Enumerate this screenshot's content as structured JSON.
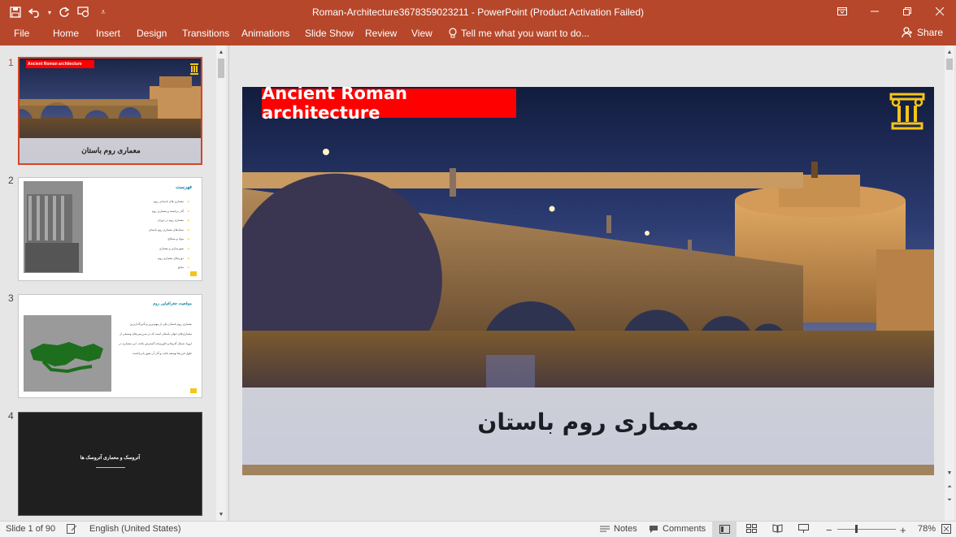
{
  "window": {
    "title": "Roman-Architecture3678359023211 - PowerPoint (Product Activation Failed)"
  },
  "qat": {
    "save_icon": "save-icon",
    "undo_icon": "undo-icon",
    "redo_icon": "repeat-icon",
    "present_icon": "present-from-start-icon",
    "customize_icon": "customize-qat-icon"
  },
  "ribbon": {
    "tabs": [
      "File",
      "Home",
      "Insert",
      "Design",
      "Transitions",
      "Animations",
      "Slide Show",
      "Review",
      "View"
    ],
    "tell_me": "Tell me what you want to do...",
    "share": "Share"
  },
  "thumbnails": [
    {
      "number": "1",
      "title": "Ancient Roman architecture",
      "subtitle": "معماری روم باستان"
    },
    {
      "number": "2",
      "heading": "فهرست",
      "items": [
        "معماری های باستانی روم",
        "آثار برجسته و معماری روم",
        "معماری روم در دوران",
        "سبک‌های معماری روم باستان",
        "مواد و مصالح",
        "شهرسازی و معماری",
        "دوره‌های معماری روم",
        "منابع"
      ]
    },
    {
      "number": "3",
      "heading": "موقعیت جغرافیایی روم",
      "paragraph": "معماری روم باستان یکی از مهم‌ترین و تأثیرگذارترین معماری‌های جهان باستان است که در سرزمین‌های وسیعی از اروپا، شمال آفریقا و خاورمیانه گسترش یافت. این معماری در طول قرن‌ها توسعه یافت و آثار آن هنوز پابرجاست"
    },
    {
      "number": "4",
      "title": "آتروسک و معماری آتروسک ها"
    }
  ],
  "slide": {
    "title": "Ancient Roman architecture",
    "subtitle": "معماری روم باستان",
    "emblem_icon": "roman-column-icon"
  },
  "status": {
    "slide_counter": "Slide 1 of 90",
    "language": "English (United States)",
    "notes": "Notes",
    "comments": "Comments",
    "zoom": "78%"
  },
  "colors": {
    "accent": "#b7472a",
    "title_banner": "#ff0000",
    "emblem": "#f5c518"
  }
}
